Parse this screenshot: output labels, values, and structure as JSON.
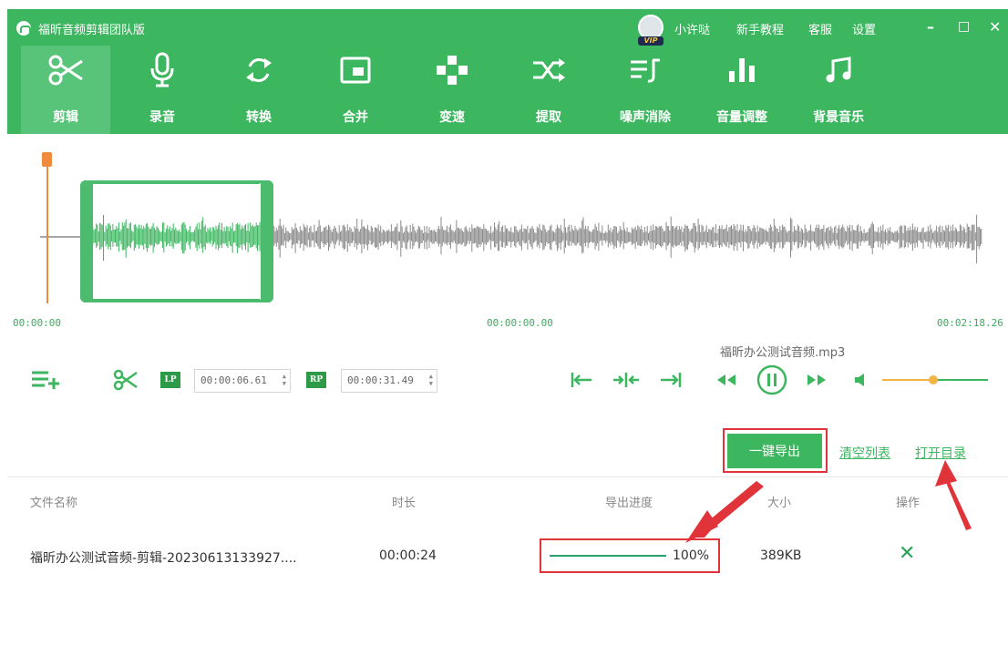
{
  "app": {
    "title": "福昕音频剪辑团队版",
    "username": "小许哒",
    "vip_badge": "VIP",
    "links": [
      "新手教程",
      "客服",
      "设置"
    ],
    "window_buttons": [
      "–",
      "□",
      "✕"
    ]
  },
  "toolbar": {
    "items": [
      {
        "label": "剪辑",
        "icon": "scissors-icon",
        "active": true
      },
      {
        "label": "录音",
        "icon": "microphone-icon"
      },
      {
        "label": "转换",
        "icon": "convert-icon"
      },
      {
        "label": "合并",
        "icon": "merge-icon"
      },
      {
        "label": "变速",
        "icon": "speed-icon"
      },
      {
        "label": "提取",
        "icon": "extract-icon"
      },
      {
        "label": "噪声消除",
        "icon": "noise-removal-icon"
      },
      {
        "label": "音量调整",
        "icon": "volume-adjust-icon"
      },
      {
        "label": "背景音乐",
        "icon": "music-note-icon"
      }
    ]
  },
  "waveform": {
    "time_start": "00:00:00",
    "time_center": "00:00:00.00",
    "time_end": "00:02:18.26"
  },
  "controls": {
    "file_name": "福昕办公测试音频.mp3",
    "lp_badge": "LP",
    "lp_time": "00:00:06.61",
    "rp_badge": "RP",
    "rp_time": "00:00:31.49",
    "volume_level": 0.48
  },
  "actions": {
    "export_label": "一键导出",
    "clear_list_label": "清空列表",
    "open_dir_label": "打开目录"
  },
  "table": {
    "headers": [
      "文件名称",
      "时长",
      "导出进度",
      "大小",
      "操作"
    ],
    "rows": [
      {
        "name": "福昕办公测试音频-剪辑-20230613133927....",
        "duration": "00:00:24",
        "progress_text": "100%",
        "progress": 1.0,
        "size": "389KB",
        "action_icon": "close-icon"
      }
    ]
  },
  "colors": {
    "brand_green": "#3db660",
    "highlight_red": "#e0333a",
    "playhead_orange": "#f08a3c"
  }
}
